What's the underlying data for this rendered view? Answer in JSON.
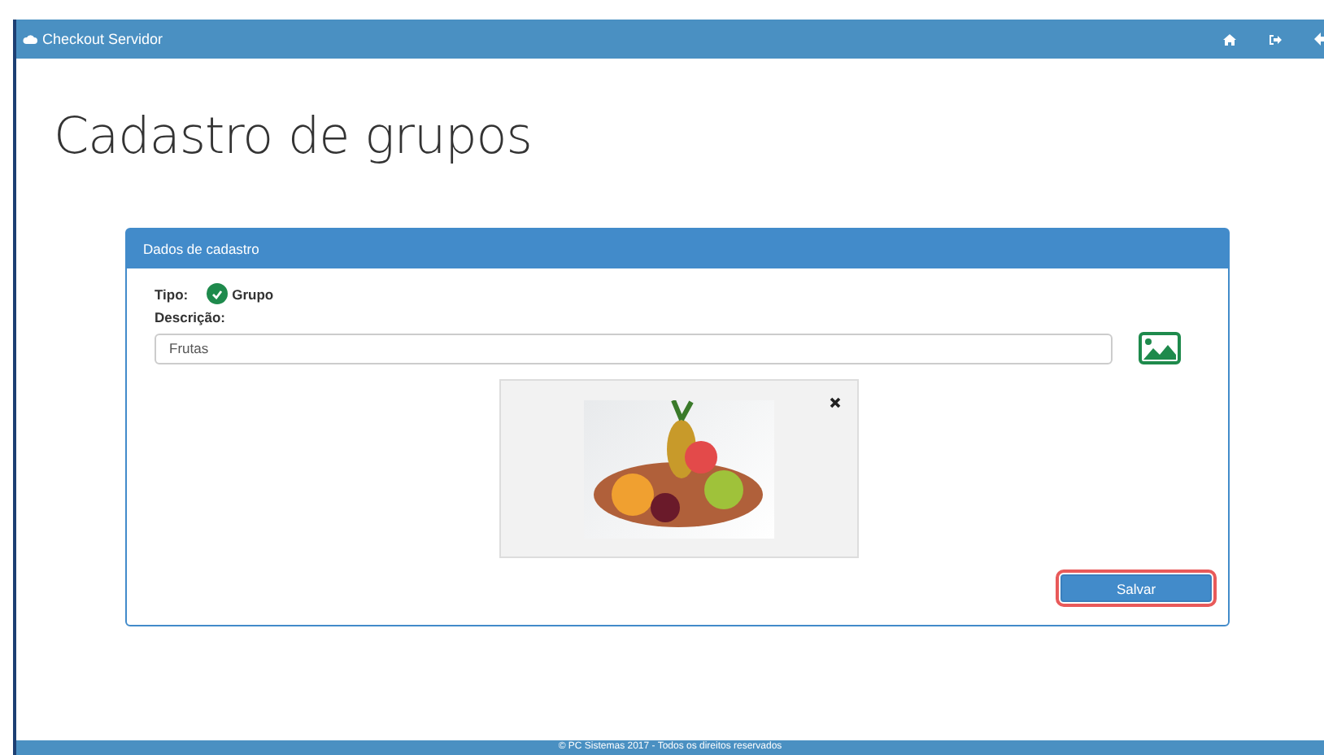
{
  "navbar": {
    "brand": "Checkout Servidor"
  },
  "page_title": "Cadastro de grupos",
  "panel": {
    "title": "Dados de cadastro",
    "tipo_label": "Tipo:",
    "tipo_value": "Grupo",
    "tipo_checked": true,
    "descricao_label": "Descrição:",
    "descricao_value": "Frutas",
    "save_button": {
      "label": "Salvar",
      "highlighted": true
    }
  },
  "footer": "© PC Sistemas 2017 - Todos os direitos reservados"
}
